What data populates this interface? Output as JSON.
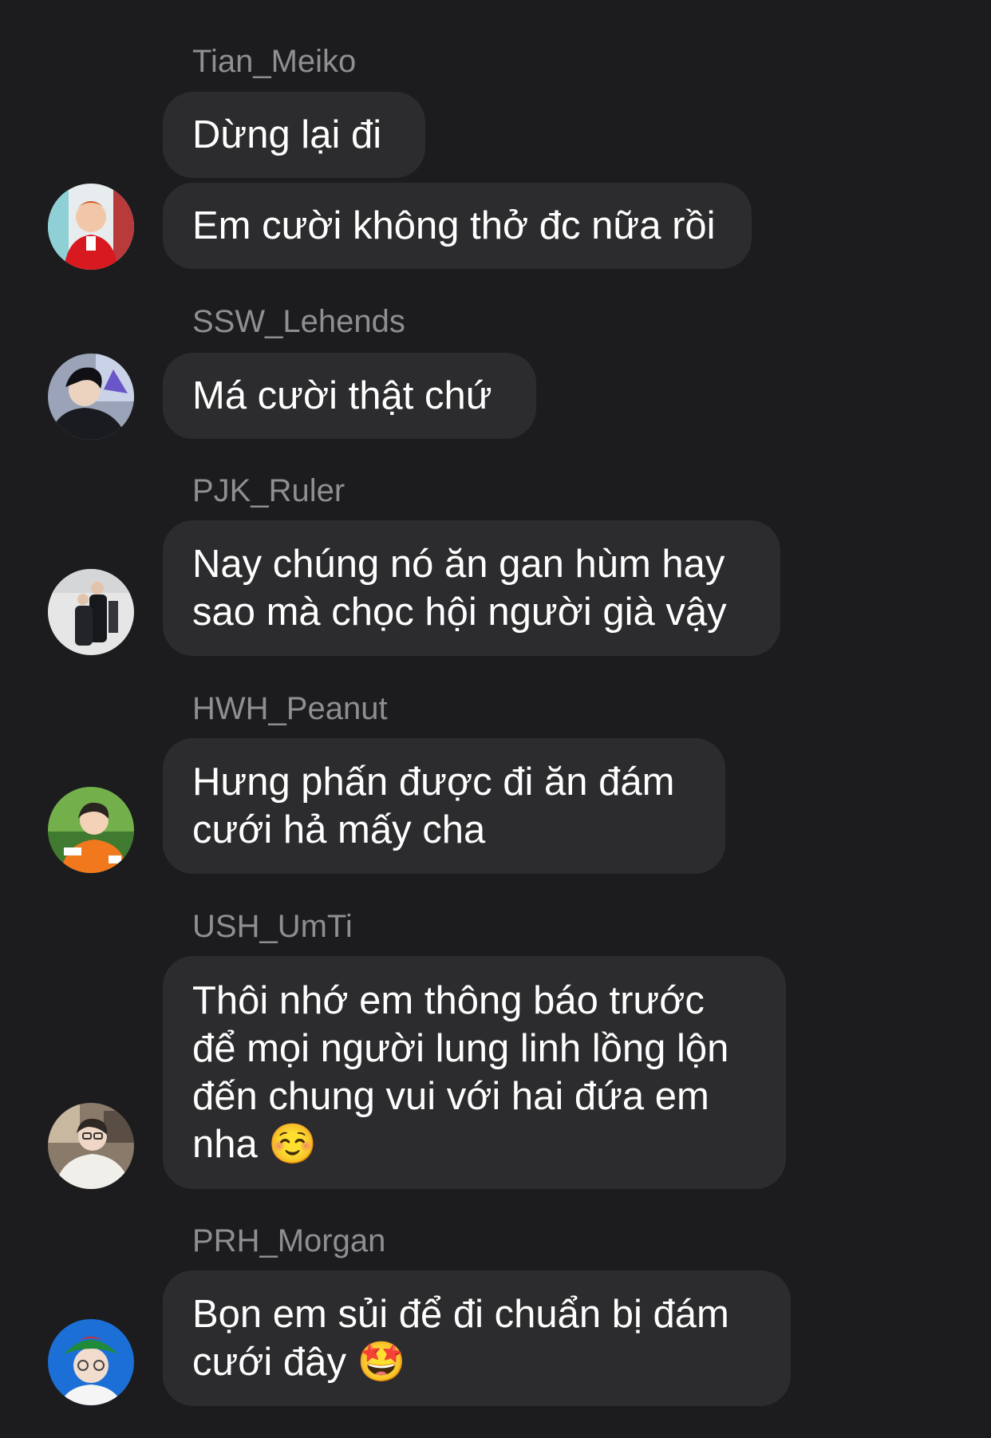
{
  "messages": [
    {
      "sender": "Tian_Meiko",
      "texts": [
        "Dừng lại đi",
        "Em cười không thở đc nữa rồi"
      ]
    },
    {
      "sender": "SSW_Lehends",
      "texts": [
        "Má cười thật chứ"
      ]
    },
    {
      "sender": "PJK_Ruler",
      "texts": [
        "Nay chúng nó ăn gan hùm hay sao mà chọc hội người già vậy"
      ]
    },
    {
      "sender": "HWH_Peanut",
      "texts": [
        "Hưng phấn được đi ăn đám cưới hả mấy cha"
      ]
    },
    {
      "sender": "USH_UmTi",
      "texts": [
        "Thôi nhớ em thông báo trước để mọi người lung linh lồng lộn đến chung vui với hai đứa em nha ☺️"
      ]
    },
    {
      "sender": "PRH_Morgan",
      "texts": [
        "Bọn em sủi để đi chuẩn bị đám cưới đây 🤩"
      ]
    }
  ],
  "colors": {
    "background": "#1c1c1e",
    "bubble": "#2c2c2e",
    "sender_name": "#8e8e93",
    "message_text": "#ffffff"
  }
}
